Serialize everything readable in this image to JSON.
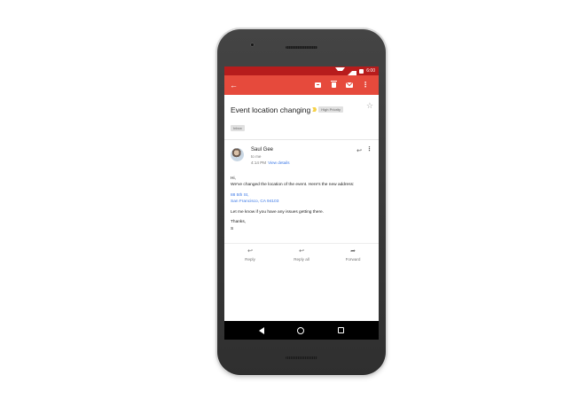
{
  "status_bar": {
    "time": "6:00"
  },
  "app_bar": {
    "back_glyph": "←",
    "more_glyph": "⋮",
    "icons": [
      "archive-icon",
      "delete-icon",
      "mark-unread-icon",
      "more-vert-icon"
    ]
  },
  "email": {
    "subject": "Event location changing",
    "priority_label": "High Priority",
    "folder_label": "Inbox",
    "star_glyph": "☆",
    "sender": {
      "name": "Saul Gee",
      "to": "to me",
      "time": "4:14 PM",
      "view_details": "View details"
    },
    "body": {
      "greeting": "Hi,",
      "line1": "We've changed the location of the event. Here's the new address:",
      "address_line1": "88 5th St,",
      "address_line2": "San Francisco, CA 94103",
      "line2": "Let me know if you have any issues getting there.",
      "signoff": "Thanks,",
      "signature": "S"
    },
    "actions": {
      "reply": "Reply",
      "reply_all": "Reply all",
      "forward": "Forward"
    },
    "glyphs": {
      "reply": "↩",
      "reply_all": "↩",
      "forward": "➦",
      "more": "⋮"
    }
  },
  "colors": {
    "app_bar": "#e64a3c",
    "status_bar": "#b71c1c",
    "link": "#3b78e7",
    "important_marker": "#f6d24a"
  }
}
